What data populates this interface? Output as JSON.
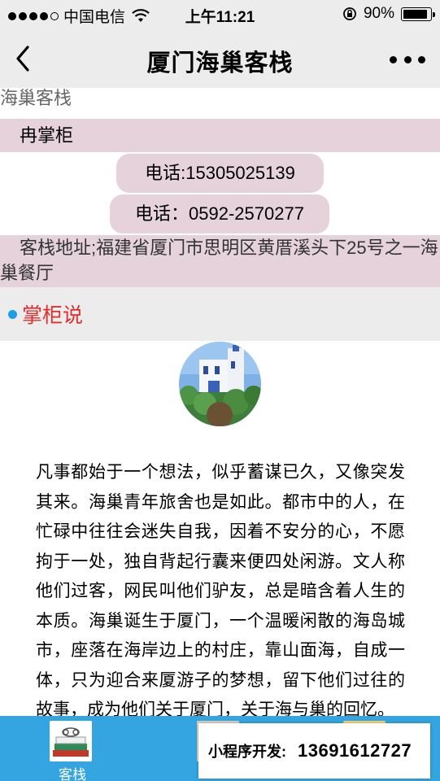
{
  "status_bar": {
    "carrier": "中国电信",
    "time": "上午11:21",
    "battery": "90%",
    "battery_level": 0.9
  },
  "nav": {
    "title": "厦门海巢客栈"
  },
  "shop": {
    "name": "海巢客栈",
    "owner": "冉掌柜",
    "phone1": "电话:15305025139",
    "phone2": "电话：0592-2570277",
    "address": "客栈地址;福建省厦门市思明区黄厝溪头下25号之一海巢餐厅"
  },
  "section": {
    "title": "掌柜说"
  },
  "story": "凡事都始于一个想法，似乎蓄谋已久，又像突发其来。海巢青年旅舍也是如此。都市中的人，在忙碌中往往会迷失自我，因着不安分的心，不愿拘于一处，独自背起行囊来便四处闲游。文人称他们过客，网民叫他们驴友，总是暗含着人生的本质。海巢诞生于厦门，一个温暖闲散的海岛城市，座落在海岸边上的村庄，靠山面海，自成一体，只为迎合来厦游子的梦想，留下他们过往的故事，成为他们关于厦门，关于海与巢的回忆。",
  "tabs": [
    {
      "label": "客栈",
      "icon": "books-icon"
    },
    {
      "label": "",
      "icon": "room-icon"
    },
    {
      "label": "",
      "icon": "food-icon"
    }
  ],
  "promo": {
    "label": "小程序开发:",
    "phone": "13691612727"
  },
  "colors": {
    "accent_pink": "#e6d2da",
    "tab_blue": "#34a5e0",
    "section_red": "#e02e2e",
    "bullet_blue": "#1a9fe8"
  }
}
